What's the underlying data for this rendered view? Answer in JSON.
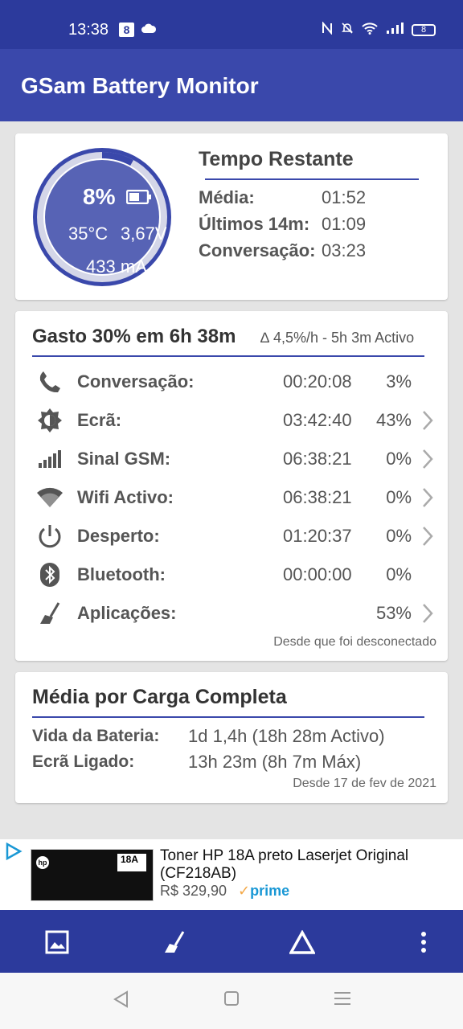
{
  "status_bar": {
    "time": "13:38",
    "badge": "8",
    "battery": "8"
  },
  "app": {
    "title": "GSam Battery Monitor"
  },
  "gauge": {
    "percent": "8%",
    "level": 0.08,
    "temperature": "35°C",
    "voltage": "3,67V",
    "current": "433 mA"
  },
  "remaining": {
    "title": "Tempo Restante",
    "rows": [
      {
        "label": "Média:",
        "value": "01:52"
      },
      {
        "label": "Últimos 14m:",
        "value": "01:09"
      },
      {
        "label": "Conversação:",
        "value": "03:23"
      }
    ]
  },
  "usage": {
    "title": "Gasto 30% em 6h 38m",
    "subtitle": "∆ 4,5%/h - 5h 3m Activo",
    "rows": [
      {
        "icon": "phone-icon",
        "label": "Conversação:",
        "time": "00:20:08",
        "pct": "3%",
        "chevron": false
      },
      {
        "icon": "screen-brightness-icon",
        "label": "Ecrã:",
        "time": "03:42:40",
        "pct": "43%",
        "chevron": true
      },
      {
        "icon": "signal-bars-icon",
        "label": "Sinal GSM:",
        "time": "06:38:21",
        "pct": "0%",
        "chevron": true
      },
      {
        "icon": "wifi-icon",
        "label": "Wifi Activo:",
        "time": "06:38:21",
        "pct": "0%",
        "chevron": true
      },
      {
        "icon": "power-icon",
        "label": "Desperto:",
        "time": "01:20:37",
        "pct": "0%",
        "chevron": true
      },
      {
        "icon": "bluetooth-icon",
        "label": "Bluetooth:",
        "time": "00:00:00",
        "pct": "0%",
        "chevron": false
      },
      {
        "icon": "broom-icon",
        "label": "Aplicações:",
        "time": "",
        "pct": "53%",
        "chevron": true
      }
    ],
    "footer": "Desde que foi desconectado"
  },
  "average": {
    "title": "Média por Carga Completa",
    "rows": [
      {
        "label": "Vida da Bateria:",
        "value": "1d 1,4h (18h 28m Activo)"
      },
      {
        "label": "Ecrã Ligado:",
        "value": "13h 23m (8h 7m Máx)"
      }
    ],
    "footer": "Desde 17 de fev de 2021"
  },
  "ad": {
    "title": "Toner HP 18A preto Laserjet Original (CF218AB)",
    "price": "R$ 329,90",
    "prime": "prime",
    "product_label": "18A",
    "brand": "hp"
  },
  "colors": {
    "primary": "#3a48ab",
    "primary_dark": "#2c3a9c",
    "gauge_fill": "#5763b5",
    "gauge_track": "#d4d6e8"
  }
}
